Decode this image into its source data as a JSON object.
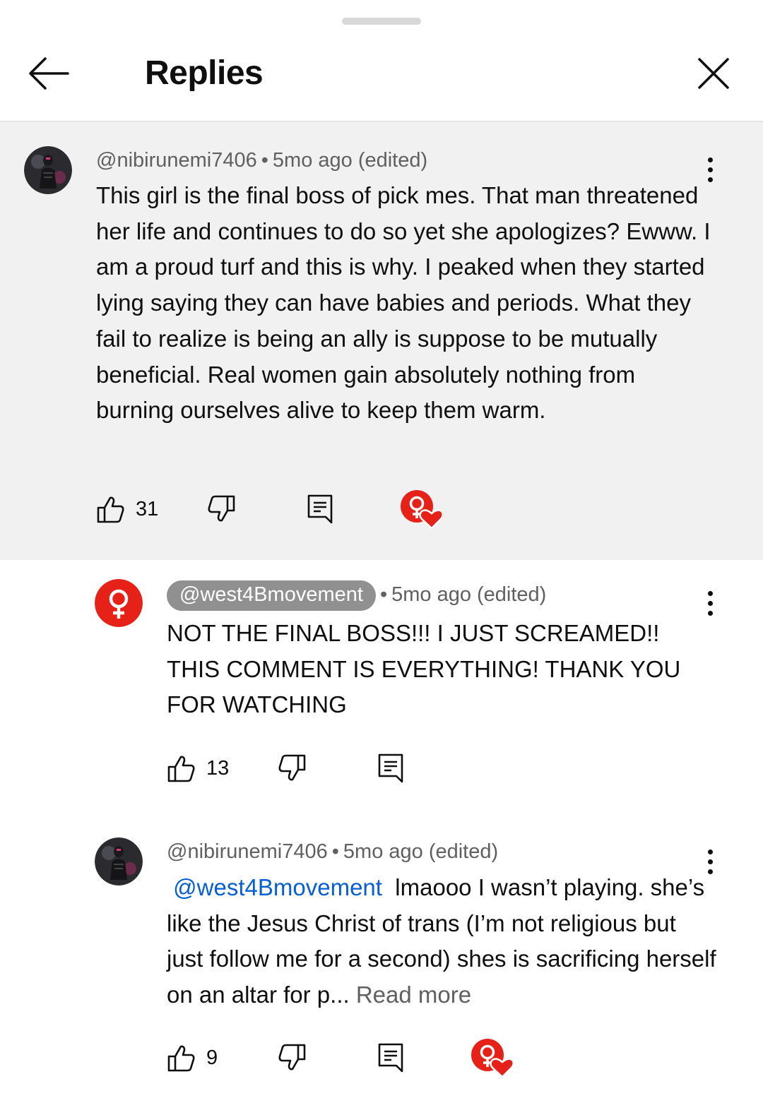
{
  "header": {
    "title": "Replies"
  },
  "comments": [
    {
      "author": "@nibirunemi7406",
      "time": "5mo ago (edited)",
      "text": "This girl is the final boss of pick mes. That man threatened her life and continues to do so yet she apologizes? Ewww. I am a proud turf and this is why. I peaked when they started lying saying they can have babies and periods. What they fail to realize is being an ally is suppose to be mutually beneficial. Real women gain absolutely nothing from burning ourselves alive to keep them warm.",
      "likes": "31",
      "creator_heart": true
    },
    {
      "author": "@west4Bmovement",
      "time": "5mo ago (edited)",
      "text": "NOT THE FINAL BOSS!!! I JUST SCREAMED!! THIS COMMENT IS EVERYTHING! THANK YOU FOR WATCHING",
      "likes": "13",
      "creator_heart": false
    },
    {
      "author": "@nibirunemi7406",
      "time": "5mo ago (edited)",
      "mention": "@west4Bmovement",
      "text": "lmaooo I wasn’t playing. she’s like the Jesus Christ of trans (I’m not religious but just follow me for a second) shes is sacrificing herself on an altar for p...",
      "read_more": "Read more",
      "likes": "9",
      "creator_heart": true
    }
  ],
  "colors": {
    "accent_red": "#e62117",
    "mention_blue": "#065fd4",
    "highlight_bg": "#f1f1f1"
  },
  "icons": [
    "back-arrow-icon",
    "close-icon",
    "thumbs-up-icon",
    "thumbs-down-icon",
    "reply-icon",
    "creator-heart-icon",
    "more-vert-icon",
    "female-symbol-icon"
  ]
}
